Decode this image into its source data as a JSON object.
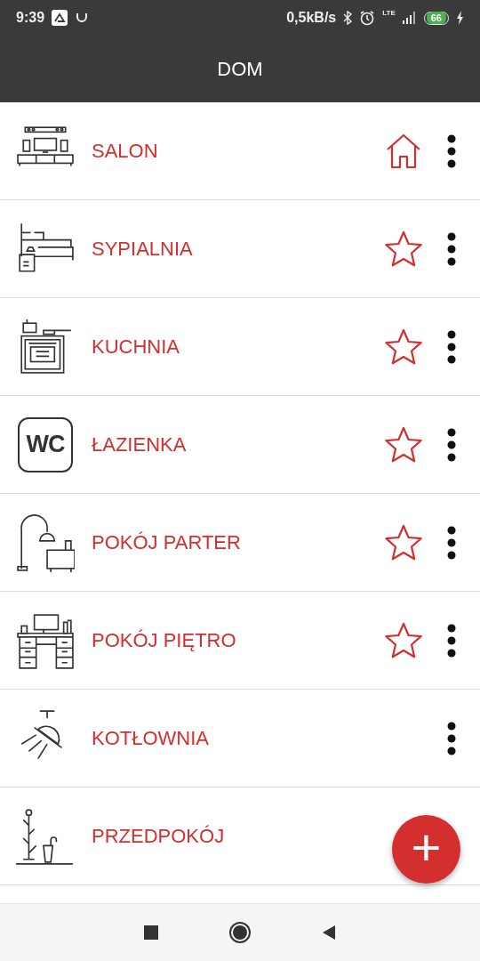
{
  "status_bar": {
    "time": "9:39",
    "speed": "0,5kB/s",
    "network": "LTE",
    "battery": "66"
  },
  "app_bar": {
    "title": "DOM"
  },
  "rooms": [
    {
      "name": "SALON",
      "default": true,
      "favorite": false,
      "menu": true
    },
    {
      "name": "SYPIALNIA",
      "default": false,
      "favorite": true,
      "menu": true
    },
    {
      "name": "KUCHNIA",
      "default": false,
      "favorite": true,
      "menu": true
    },
    {
      "icon_text": "WC",
      "name": "ŁAZIENKA",
      "default": false,
      "favorite": true,
      "menu": true
    },
    {
      "name": "POKÓJ PARTER",
      "default": false,
      "favorite": true,
      "menu": true
    },
    {
      "name": "POKÓJ PIĘTRO",
      "default": false,
      "favorite": true,
      "menu": true
    },
    {
      "name": "KOTŁOWNIA",
      "default": false,
      "favorite": false,
      "menu": true
    },
    {
      "name": "PRZEDPOKÓJ",
      "default": false,
      "favorite": false,
      "menu": false
    }
  ],
  "fab": {
    "symbol": "+"
  }
}
